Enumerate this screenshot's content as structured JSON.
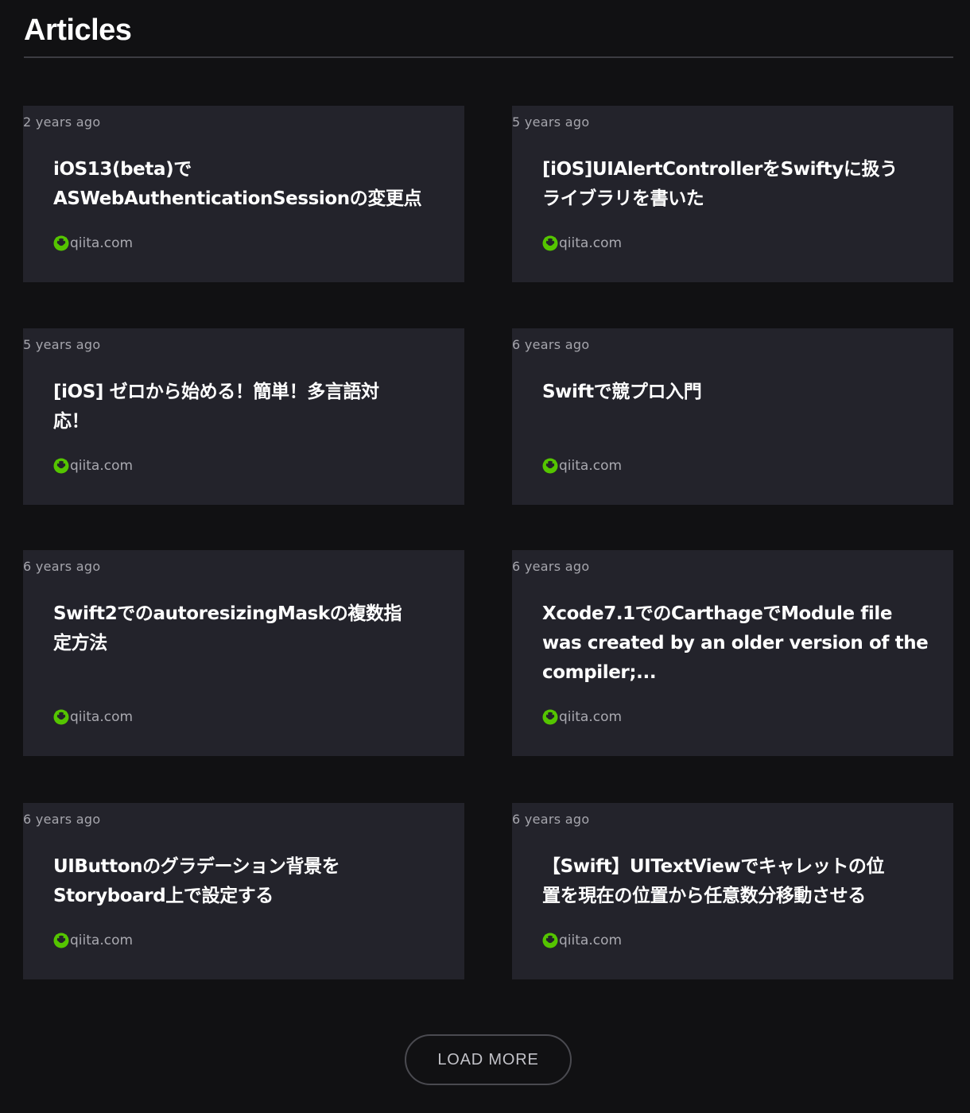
{
  "header": {
    "title": "Articles"
  },
  "articles": [
    {
      "time": "2 years ago",
      "title": "iOS13(beta)でASWebAuthenticationSessionの変更点",
      "title_lines": [
        "iOS13(beta)で",
        "ASWebAuthenticationSessionの変更点"
      ],
      "source": "qiita.com",
      "source_icon": "qiita-icon"
    },
    {
      "time": "5 years ago",
      "title": "[iOS]UIAlertControllerをSwiftyに扱うライブラリを書いた",
      "title_lines": [
        "[iOS]UIAlertControllerをSwiftyに扱う",
        "ライブラリを書いた"
      ],
      "source": "qiita.com",
      "source_icon": "qiita-icon"
    },
    {
      "time": "5 years ago",
      "title": "[iOS] ゼロから始める！簡単！多言語対応！",
      "title_lines": [
        "[iOS] ゼロから始める！簡単！多言語対",
        "応！"
      ],
      "source": "qiita.com",
      "source_icon": "qiita-icon"
    },
    {
      "time": "6 years ago",
      "title": "Swiftで競プロ入門",
      "title_lines": [
        "Swiftで競プロ入門"
      ],
      "source": "qiita.com",
      "source_icon": "qiita-icon"
    },
    {
      "time": "6 years ago",
      "title": "Swift2でのautoresizingMaskの複数指定方法",
      "title_lines": [
        "Swift2でのautoresizingMaskの複数指",
        "定方法"
      ],
      "source": "qiita.com",
      "source_icon": "qiita-icon"
    },
    {
      "time": "6 years ago",
      "title": "Xcode7.1でのCarthageでModule file was created by an older version of the compiler;...",
      "title_lines": [
        "Xcode7.1でのCarthageでModule file",
        "was created by an older version of the",
        "compiler;..."
      ],
      "source": "qiita.com",
      "source_icon": "qiita-icon"
    },
    {
      "time": "6 years ago",
      "title": "UIButtonのグラデーション背景をStoryboard上で設定する",
      "title_lines": [
        "UIButtonのグラデーション背景を",
        "Storyboard上で設定する"
      ],
      "source": "qiita.com",
      "source_icon": "qiita-icon"
    },
    {
      "time": "6 years ago",
      "title": "【Swift】UITextViewでキャレットの位置を現在の位置から任意数分移動させる",
      "title_lines": [
        "【Swift】UITextViewでキャレットの位",
        "置を現在の位置から任意数分移動させる"
      ],
      "source": "qiita.com",
      "source_icon": "qiita-icon"
    }
  ],
  "footer": {
    "load_more_label": "LOAD MORE"
  },
  "colors": {
    "background": "#111113",
    "card": "#23232b",
    "qiita_green": "#55c500"
  }
}
